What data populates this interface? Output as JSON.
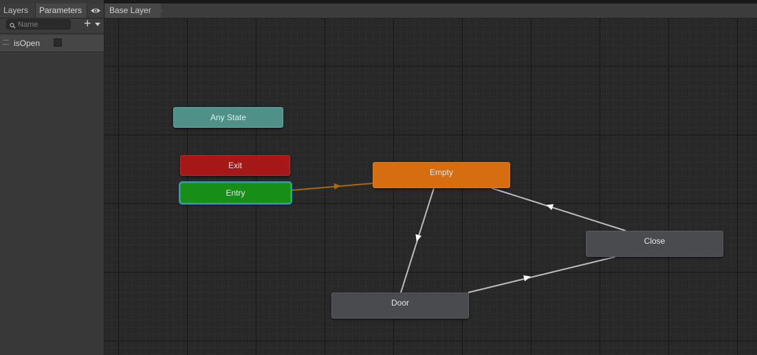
{
  "tabs": [
    {
      "label": "Layers"
    },
    {
      "label": "Parameters"
    }
  ],
  "search": {
    "placeholder": "Name"
  },
  "parameters": [
    {
      "name": "isOpen",
      "type": "bool",
      "value": false
    }
  ],
  "breadcrumb": {
    "label": "Base Layer"
  },
  "states": {
    "any_state": {
      "label": "Any State"
    },
    "exit": {
      "label": "Exit"
    },
    "entry": {
      "label": "Entry"
    },
    "empty": {
      "label": "Empty"
    },
    "close": {
      "label": "Close"
    },
    "door": {
      "label": "Door"
    }
  },
  "transitions": [
    {
      "from": "Entry",
      "to": "Empty"
    },
    {
      "from": "Empty",
      "to": "Door"
    },
    {
      "from": "Door",
      "to": "Close"
    },
    {
      "from": "Close",
      "to": "Empty"
    }
  ],
  "colors": {
    "any_state": "#4f9189",
    "exit": "#a51818",
    "entry": "#178e17",
    "default_state": "#d66d10",
    "state": "#4a4b4e",
    "selection": "#3c8ecf",
    "default_transition": "#a86a10",
    "transition": "#bdbdbd"
  }
}
